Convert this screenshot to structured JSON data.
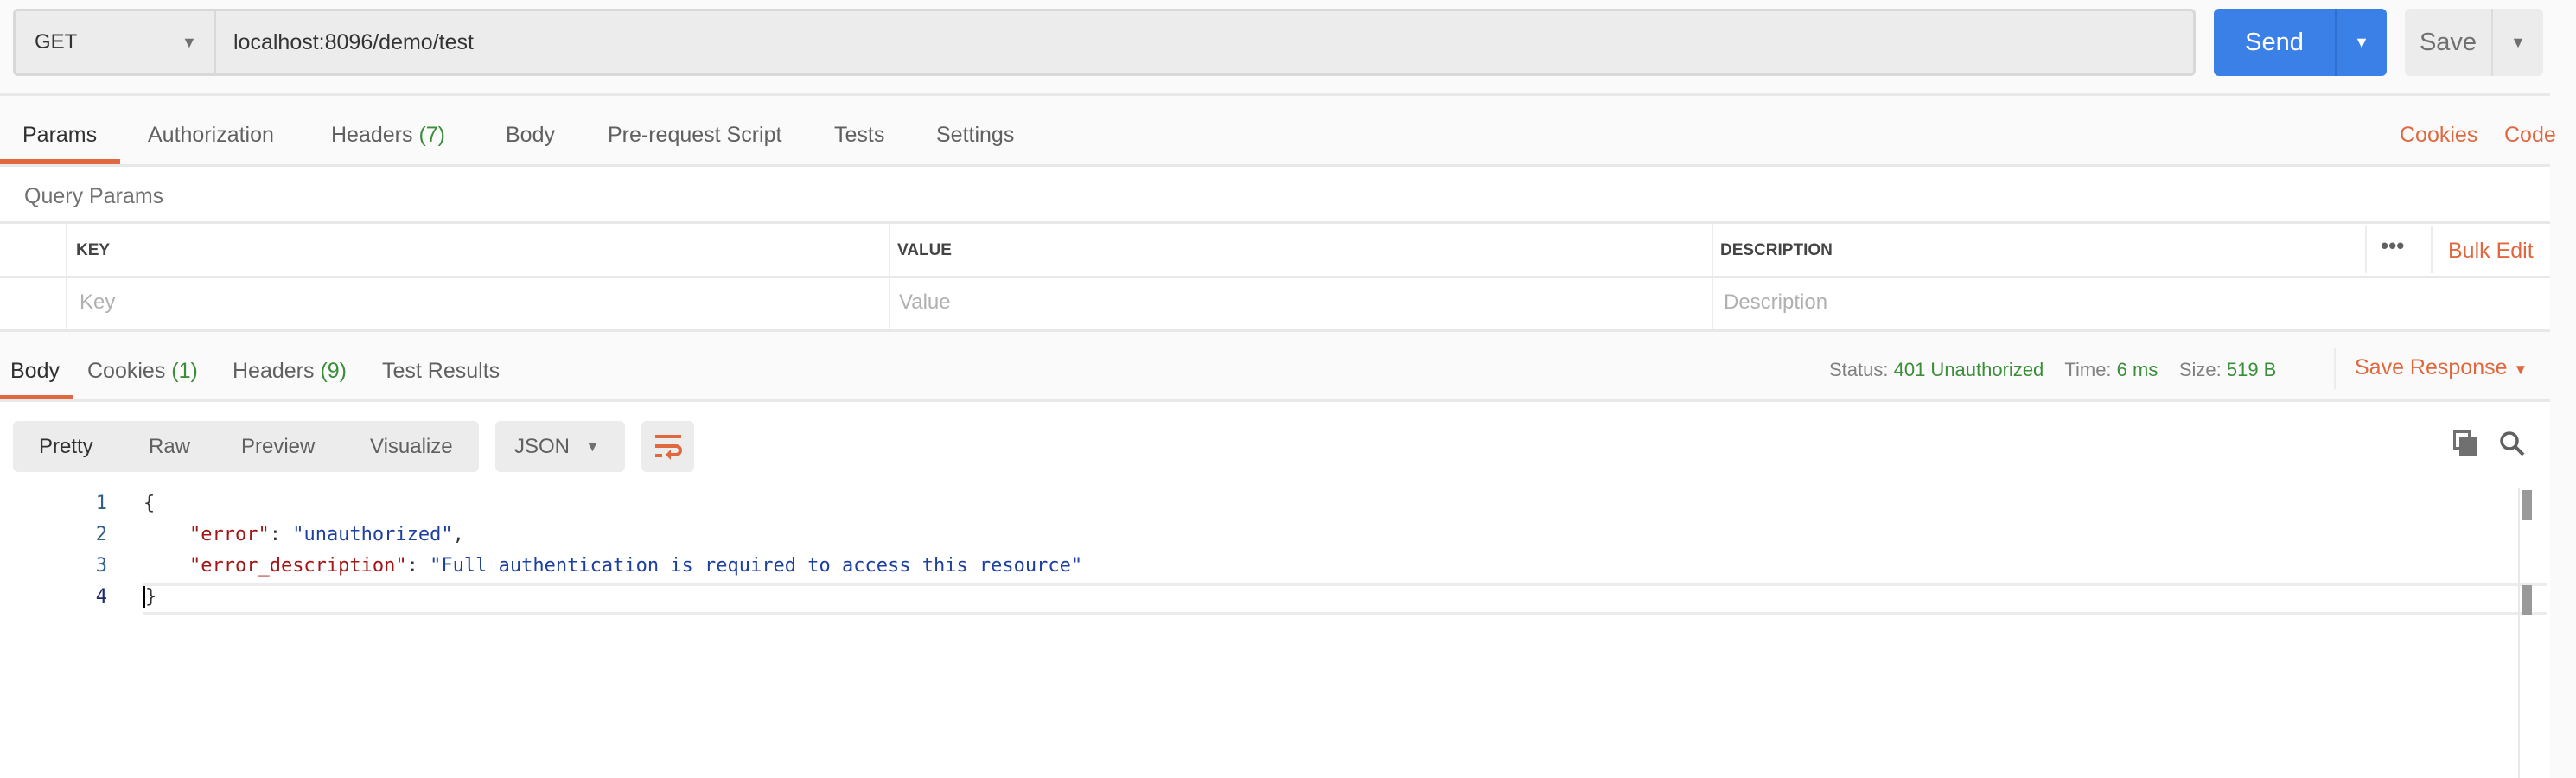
{
  "request": {
    "method": "GET",
    "url": "localhost:8096/demo/test",
    "send_label": "Send",
    "save_label": "Save"
  },
  "request_tabs": [
    {
      "label": "Params",
      "active": true
    },
    {
      "label": "Authorization"
    },
    {
      "label": "Headers",
      "count": "(7)"
    },
    {
      "label": "Body"
    },
    {
      "label": "Pre-request Script"
    },
    {
      "label": "Tests"
    },
    {
      "label": "Settings"
    }
  ],
  "request_links": {
    "cookies": "Cookies",
    "code": "Code"
  },
  "query_params": {
    "title": "Query Params",
    "columns": [
      "KEY",
      "VALUE",
      "DESCRIPTION"
    ],
    "bulk_edit": "Bulk Edit",
    "placeholders": {
      "key": "Key",
      "value": "Value",
      "description": "Description"
    }
  },
  "response_tabs": [
    {
      "label": "Body",
      "active": true
    },
    {
      "label": "Cookies",
      "count": "(1)"
    },
    {
      "label": "Headers",
      "count": "(9)"
    },
    {
      "label": "Test Results"
    }
  ],
  "response_meta": {
    "status_label": "Status:",
    "status": "401 Unauthorized",
    "time_label": "Time:",
    "time": "6 ms",
    "size_label": "Size:",
    "size": "519 B",
    "save_response": "Save Response"
  },
  "view_modes": [
    "Pretty",
    "Raw",
    "Preview",
    "Visualize"
  ],
  "format": "JSON",
  "code_lines": [
    {
      "n": "1",
      "t": "{"
    },
    {
      "n": "2",
      "key": "\"error\"",
      "val": "\"unauthorized\"",
      "end": ","
    },
    {
      "n": "3",
      "key": "\"error_description\"",
      "val": "\"Full authentication is required to access this resource\"",
      "end": ""
    },
    {
      "n": "4",
      "t": "}"
    }
  ],
  "colors": {
    "accent": "#e0683f",
    "send": "#3a80e7",
    "success": "#3a8e3a"
  }
}
